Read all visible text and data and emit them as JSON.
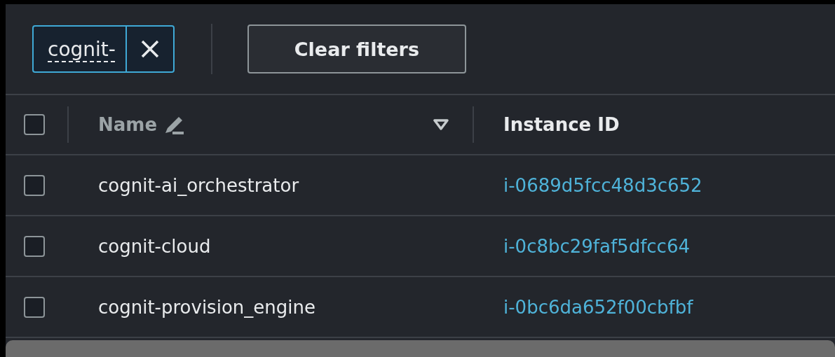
{
  "filter_token": {
    "value": "cognit-"
  },
  "clear_button": "Clear filters",
  "select_all": {
    "checked": false
  },
  "columns": [
    {
      "label": "Name",
      "editable": true,
      "filterable": true
    },
    {
      "label": "Instance ID",
      "editable": false,
      "filterable": false
    }
  ],
  "rows": [
    {
      "checked": false,
      "name": "cognit-ai_orchestrator",
      "instance_id": "i-0689d5fcc48d3c652"
    },
    {
      "checked": false,
      "name": "cognit-cloud",
      "instance_id": "i-0c8bc29faf5dfcc64"
    },
    {
      "checked": false,
      "name": "cognit-provision_engine",
      "instance_id": "i-0bc6da652f00cbfbf"
    }
  ]
}
